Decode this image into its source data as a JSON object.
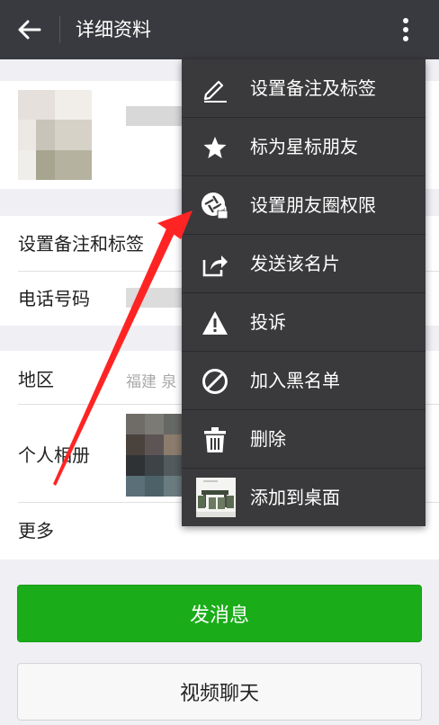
{
  "header": {
    "title": "详细资料"
  },
  "profile": {
    "rows": [
      {
        "label": "设置备注和标签"
      },
      {
        "label": "电话号码"
      }
    ],
    "region": {
      "label": "地区",
      "value": "福建  泉"
    },
    "album": {
      "label": "个人相册"
    },
    "more": {
      "label": "更多"
    }
  },
  "buttons": {
    "message": "发消息",
    "video": "视频聊天"
  },
  "menu": {
    "items": [
      {
        "label": "设置备注及标签",
        "icon": "pencil-icon"
      },
      {
        "label": "标为星标朋友",
        "icon": "star-icon"
      },
      {
        "label": "设置朋友圈权限",
        "icon": "moments-lock-icon"
      },
      {
        "label": "发送该名片",
        "icon": "share-icon"
      },
      {
        "label": "投诉",
        "icon": "warning-icon"
      },
      {
        "label": "加入黑名单",
        "icon": "block-icon"
      },
      {
        "label": "删除",
        "icon": "trash-icon"
      },
      {
        "label": "添加到桌面",
        "icon": "desktop-thumbnail-icon"
      }
    ]
  },
  "colors": {
    "header": "#393a3f",
    "primary": "#1aad19",
    "annotation": "#ff2a2a",
    "menu": "#3a3a3c"
  }
}
